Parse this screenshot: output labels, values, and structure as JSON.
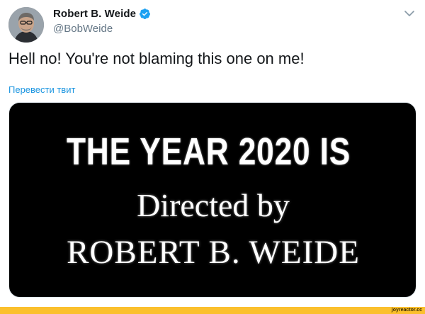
{
  "author": {
    "display_name": "Robert B. Weide",
    "handle": "@BobWeide",
    "verified": true,
    "avatar_icon": "profile-photo"
  },
  "icons": {
    "verified": "verified-badge-icon",
    "menu": "chevron-down-icon"
  },
  "tweet": {
    "text": "Hell no! You're not blaming this one on me!",
    "translate_label": "Перевести твит"
  },
  "media": {
    "line1": "THE YEAR 2020 IS",
    "line2": "Directed by",
    "line3": "ROBERT B. WEIDE"
  },
  "footer": {
    "watermark": "joyreactor.cc"
  },
  "colors": {
    "text_primary": "#14171a",
    "text_secondary": "#657786",
    "link": "#1b95e0",
    "verified_badge": "#1da1f2",
    "media_background": "#000000",
    "footer_bar": "#fbc02d"
  }
}
